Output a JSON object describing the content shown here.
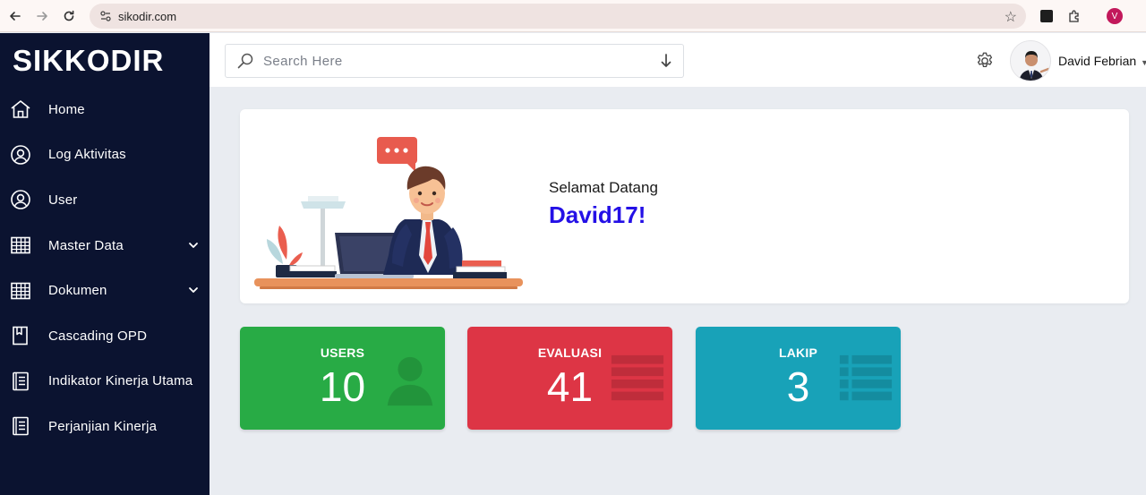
{
  "browser": {
    "url": "sikodir.com",
    "profile_initial": "V"
  },
  "sidebar": {
    "brand": "SIKKODIR",
    "items": [
      {
        "label": "Home",
        "icon": "home-icon"
      },
      {
        "label": "Log Aktivitas",
        "icon": "user-circle-icon"
      },
      {
        "label": "User",
        "icon": "user-circle-icon"
      },
      {
        "label": "Master Data",
        "icon": "table-icon",
        "has_submenu": true
      },
      {
        "label": "Dokumen",
        "icon": "table-icon",
        "has_submenu": true
      },
      {
        "label": "Cascading OPD",
        "icon": "book-icon"
      },
      {
        "label": "Indikator Kinerja Utama",
        "icon": "notebook-icon"
      },
      {
        "label": "Perjanjian Kinerja",
        "icon": "notebook-icon"
      }
    ]
  },
  "header": {
    "search_placeholder": "Search Here",
    "user_name": "David Febrian"
  },
  "welcome": {
    "greeting": "Selamat Datang",
    "name": "David17!"
  },
  "stats": {
    "users": {
      "label": "USERS",
      "value": "10",
      "color": "#28ab45"
    },
    "evaluasi": {
      "label": "EVALUASI",
      "value": "41",
      "color": "#dd3545"
    },
    "lakip": {
      "label": "LAKIP",
      "value": "3",
      "color": "#18a2b8"
    }
  },
  "colors": {
    "sidebar_bg": "#0b1330",
    "accent_name": "#2410e6",
    "page_bg": "#e9ecf1"
  }
}
